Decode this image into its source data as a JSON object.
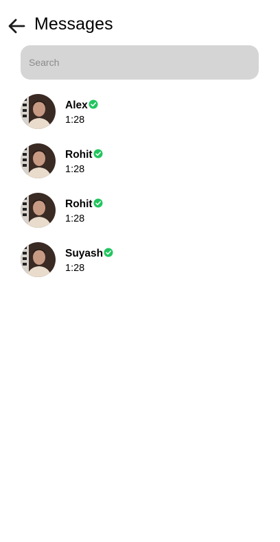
{
  "header": {
    "title": "Messages",
    "back_icon": "arrow-left-icon"
  },
  "search": {
    "placeholder": "Search",
    "value": ""
  },
  "conversations": [
    {
      "name": "Alex",
      "time": "1:28",
      "verified": true
    },
    {
      "name": "Rohit",
      "time": "1:28",
      "verified": true
    },
    {
      "name": "Rohit",
      "time": "1:28",
      "verified": true
    },
    {
      "name": "Suyash",
      "time": "1:28",
      "verified": true
    }
  ],
  "colors": {
    "verified_badge": "#22c55e",
    "search_background": "#d5d5d5",
    "text": "#000000"
  }
}
